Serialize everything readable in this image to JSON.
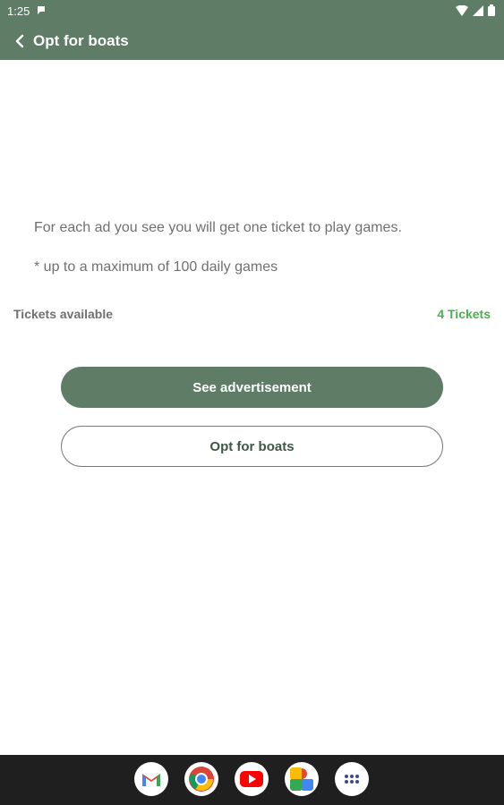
{
  "status_bar": {
    "time": "1:25"
  },
  "app_bar": {
    "title": "Opt for boats"
  },
  "content": {
    "info_text": "For each ad you see you will get one ticket to play games.",
    "limit_text": "* up to a maximum of 100 daily games",
    "tickets_label": "Tickets available",
    "tickets_value": "4 Tickets"
  },
  "actions": {
    "primary_label": "See advertisement",
    "secondary_label": "Opt for boats"
  },
  "dock": {
    "apps": [
      "gmail-icon",
      "chrome-icon",
      "youtube-icon",
      "photos-icon",
      "app-drawer-icon"
    ]
  },
  "colors": {
    "primary": "#5f7c67",
    "accent_green": "#4caf50",
    "text_gray": "#707070",
    "navbar": "#1f1f1f"
  }
}
